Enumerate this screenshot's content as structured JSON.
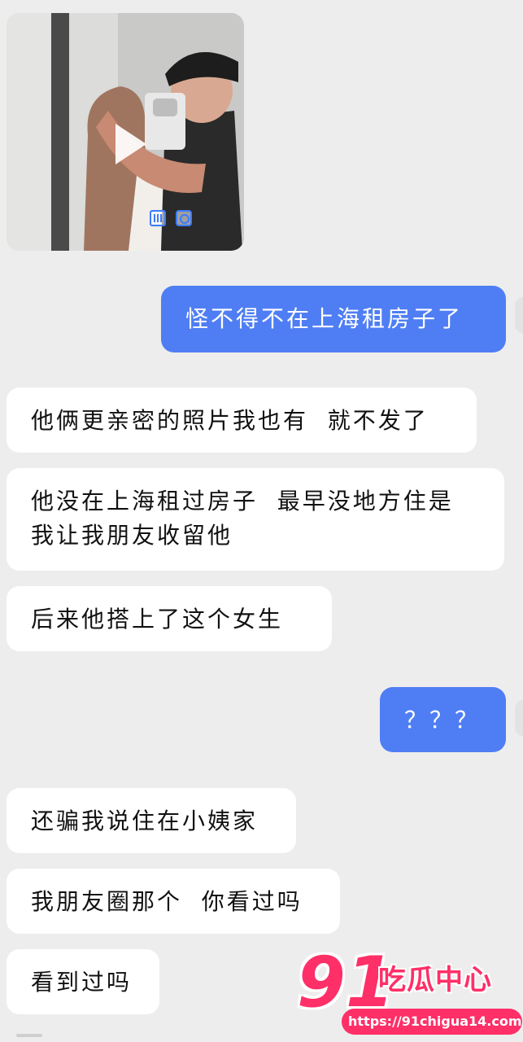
{
  "chat": {
    "media_message": {
      "type": "image",
      "play_icon": "play-icon",
      "overlay_icons": [
        "live-photo-icon",
        "timer-icon"
      ]
    },
    "messages": [
      {
        "side": "out",
        "text": "怪不得不在上海租房子了"
      },
      {
        "side": "in",
        "text": "他俩更亲密的照片我也有  就不发了"
      },
      {
        "side": "in",
        "text": "他没在上海租过房子  最早没地方住是\n我让我朋友收留他"
      },
      {
        "side": "in",
        "text": "后来他搭上了这个女生"
      },
      {
        "side": "out",
        "text": "？？？"
      },
      {
        "side": "in",
        "text": "还骗我说住在小姨家"
      },
      {
        "side": "in",
        "text": "我朋友圈那个  你看过吗"
      },
      {
        "side": "in",
        "text": "看到过吗"
      }
    ]
  },
  "watermark": {
    "number": "91",
    "name": "吃瓜中心",
    "url": "https://91chigua14.com"
  },
  "colors": {
    "background": "#ededed",
    "incoming_bubble": "#ffffff",
    "outgoing_bubble": "#4f7ef4",
    "watermark": "#ff2f67"
  }
}
